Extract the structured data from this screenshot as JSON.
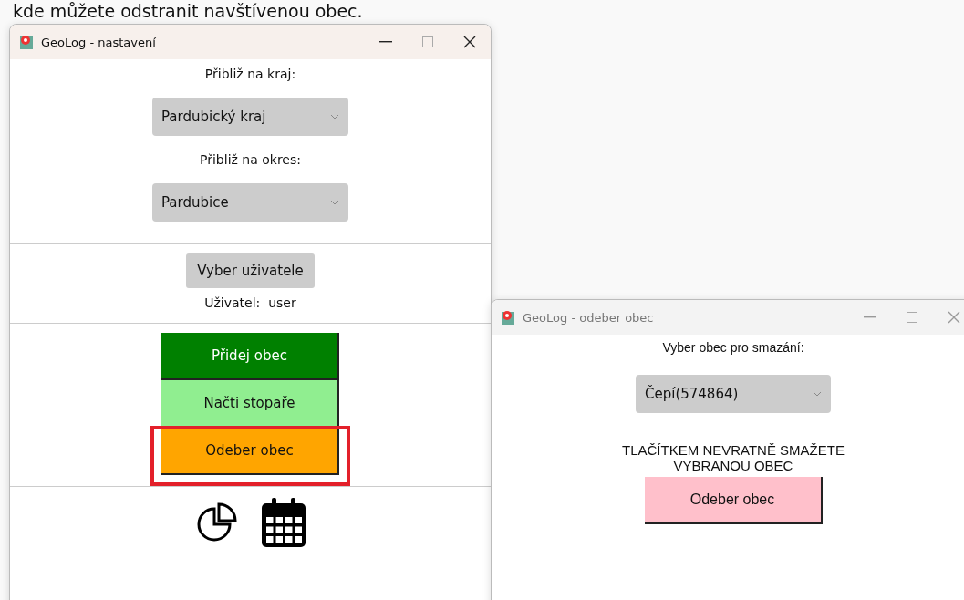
{
  "caption": "kde můžete odstranit navštívenou obec.",
  "settings_window": {
    "title": "GeoLog - nastavení",
    "region_label": "Přibliž na kraj:",
    "region_select": "Pardubický kraj",
    "district_label": "Přibliž na okres:",
    "district_select": "Pardubice",
    "user_button": "Vyber uživatele",
    "user_label": "Uživatel:",
    "user_value": "user",
    "actions": [
      {
        "label": "Přidej obec",
        "color": "#008000",
        "highlighted": false
      },
      {
        "label": "Načti stopaře",
        "color": "#90ee90",
        "highlighted": false
      },
      {
        "label": "Odeber obec",
        "color": "#ffa500",
        "highlighted": true
      }
    ]
  },
  "remove_window": {
    "title": "GeoLog - odeber obec",
    "select_label": "Vyber obec pro smazání:",
    "select": "Čepí(574864)",
    "warning": "TLAČÍTKEM NEVRATNĚ SMAŽETE VYBRANOU OBEC",
    "button": "Odeber obec"
  }
}
